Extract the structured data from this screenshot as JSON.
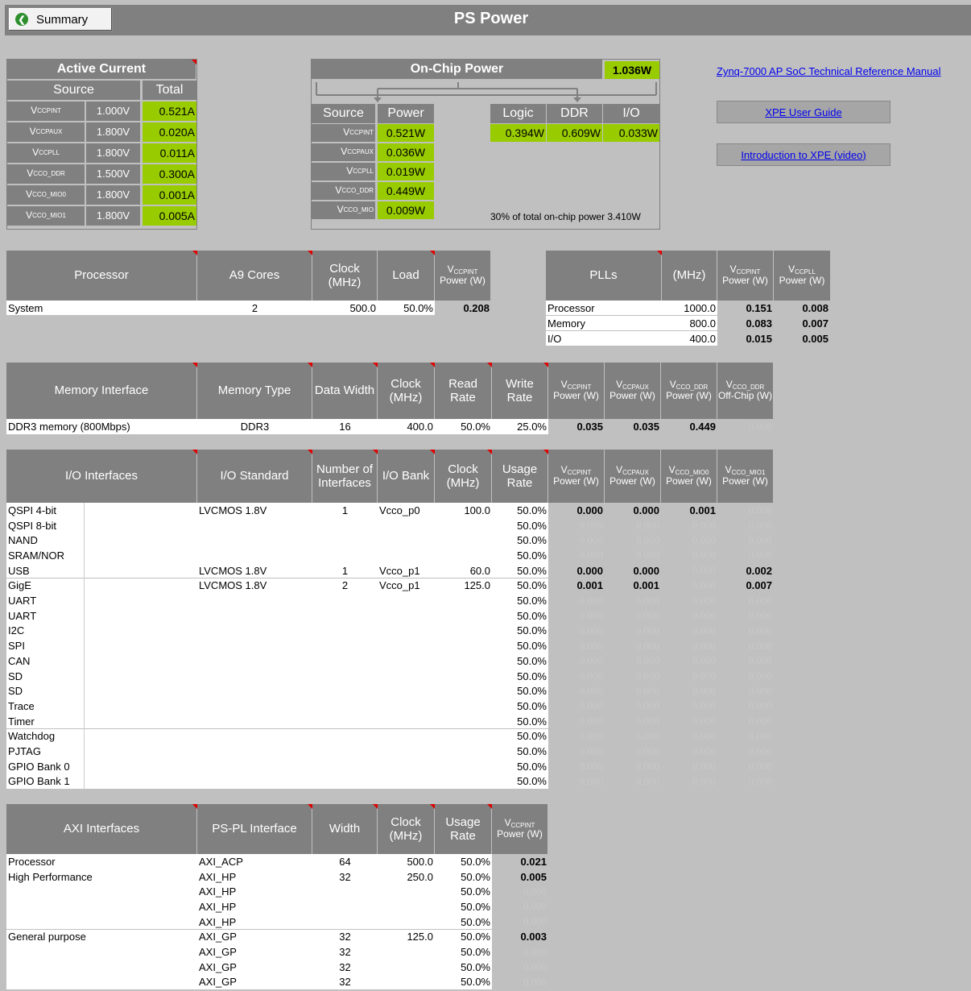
{
  "summary_label": "Summary",
  "page_title": "PS Power",
  "links": [
    "Zynq-7000 AP SoC Technical Reference Manual",
    "XPE User Guide",
    "Introduction to XPE (video)"
  ],
  "active_current": {
    "title": "Active Current",
    "headers": [
      "Source",
      "Total"
    ],
    "rows": [
      {
        "src": "CCPINT",
        "v": "1.000V",
        "a": "0.521A"
      },
      {
        "src": "CCPAUX",
        "v": "1.800V",
        "a": "0.020A"
      },
      {
        "src": "CCPLL",
        "v": "1.800V",
        "a": "0.011A"
      },
      {
        "src": "CCO_DDR",
        "v": "1.500V",
        "a": "0.300A"
      },
      {
        "src": "CCO_MIO0",
        "v": "1.800V",
        "a": "0.001A"
      },
      {
        "src": "CCO_MIO1",
        "v": "1.800V",
        "a": "0.005A"
      }
    ]
  },
  "onchip": {
    "title": "On-Chip Power",
    "total": "1.036W",
    "headers": [
      "Source",
      "Power",
      "Logic",
      "DDR",
      "I/O"
    ],
    "rows": [
      {
        "src": "CCPINT",
        "p": "0.521W"
      },
      {
        "src": "CCPAUX",
        "p": "0.036W"
      },
      {
        "src": "CCPLL",
        "p": "0.019W"
      },
      {
        "src": "CCO_DDR",
        "p": "0.449W"
      },
      {
        "src": "CCO_MIO",
        "p": "0.009W"
      }
    ],
    "logic": "0.394W",
    "ddr": "0.609W",
    "io": "0.033W",
    "note": "30% of total on-chip power 3.410W"
  },
  "processor": {
    "headers": [
      "Processor",
      "A9 Cores",
      "Clock (MHz)",
      "Load",
      "Power (W)"
    ],
    "row": {
      "name": "System",
      "cores": "2",
      "clock": "500.0",
      "load": "50.0%",
      "power": "0.208"
    }
  },
  "plls": {
    "headers": [
      "PLLs",
      "(MHz)",
      "Power (W)",
      "Power (W)"
    ],
    "rows": [
      {
        "name": "Processor",
        "mhz": "1000.0",
        "p1": "0.151",
        "p2": "0.008"
      },
      {
        "name": "Memory",
        "mhz": "800.0",
        "p1": "0.083",
        "p2": "0.007"
      },
      {
        "name": "I/O",
        "mhz": "400.0",
        "p1": "0.015",
        "p2": "0.005"
      }
    ]
  },
  "memory": {
    "headers": [
      "Memory Interface",
      "Memory Type",
      "Data Width",
      "Clock (MHz)",
      "Read Rate",
      "Write Rate",
      "Power (W)",
      "Power (W)",
      "Power (W)",
      "Off-Chip (W)"
    ],
    "row": {
      "name": "DDR3 memory (800Mbps)",
      "type": "DDR3",
      "width": "16",
      "clock": "400.0",
      "read": "50.0%",
      "write": "25.0%",
      "p1": "0.035",
      "p2": "0.035",
      "p3": "0.449",
      "p4": "0.000"
    }
  },
  "io": {
    "headers": [
      "I/O Interfaces",
      "I/O Standard",
      "Number of Interfaces",
      "I/O Bank",
      "Clock (MHz)",
      "Usage Rate",
      "Power (W)",
      "Power (W)",
      "Power (W)",
      "Power (W)"
    ],
    "rows": [
      {
        "name": "QSPI 4-bit",
        "std": "LVCMOS 1.8V",
        "num": "1",
        "bank": "Vcco_p0",
        "clk": "100.0",
        "rate": "50.0%",
        "p": [
          "0.000",
          "0.000",
          "0.001",
          "0.000"
        ],
        "on": [
          1,
          1,
          1,
          0
        ]
      },
      {
        "name": "QSPI 8-bit",
        "std": "",
        "num": "",
        "bank": "",
        "clk": "",
        "rate": "50.0%",
        "p": [
          "0.000",
          "0.000",
          "0.000",
          "0.000"
        ],
        "on": [
          0,
          0,
          0,
          0
        ]
      },
      {
        "name": "NAND",
        "std": "",
        "num": "",
        "bank": "",
        "clk": "",
        "rate": "50.0%",
        "p": [
          "0.000",
          "0.000",
          "0.000",
          "0.000"
        ],
        "on": [
          0,
          0,
          0,
          0
        ]
      },
      {
        "name": "SRAM/NOR",
        "std": "",
        "num": "",
        "bank": "",
        "clk": "",
        "rate": "50.0%",
        "p": [
          "0.000",
          "0.000",
          "0.000",
          "0.000"
        ],
        "on": [
          0,
          0,
          0,
          0
        ]
      },
      {
        "name": "USB",
        "std": "LVCMOS 1.8V",
        "num": "1",
        "bank": "Vcco_p1",
        "clk": "60.0",
        "rate": "50.0%",
        "p": [
          "0.000",
          "0.000",
          "0.000",
          "0.002"
        ],
        "on": [
          1,
          1,
          0,
          1
        ]
      },
      {
        "name": "GigE",
        "std": "LVCMOS 1.8V",
        "num": "2",
        "bank": "Vcco_p1",
        "clk": "125.0",
        "rate": "50.0%",
        "p": [
          "0.001",
          "0.001",
          "0.000",
          "0.007"
        ],
        "on": [
          1,
          1,
          0,
          1
        ]
      },
      {
        "name": "UART",
        "std": "",
        "num": "",
        "bank": "",
        "clk": "",
        "rate": "50.0%",
        "p": [
          "0.000",
          "0.000",
          "0.000",
          "0.000"
        ],
        "on": [
          0,
          0,
          0,
          0
        ]
      },
      {
        "name": "UART",
        "std": "",
        "num": "",
        "bank": "",
        "clk": "",
        "rate": "50.0%",
        "p": [
          "0.000",
          "0.000",
          "0.000",
          "0.000"
        ],
        "on": [
          0,
          0,
          0,
          0
        ]
      },
      {
        "name": "I2C",
        "std": "",
        "num": "",
        "bank": "",
        "clk": "",
        "rate": "50.0%",
        "p": [
          "0.000",
          "0.000",
          "0.000",
          "0.000"
        ],
        "on": [
          0,
          0,
          0,
          0
        ]
      },
      {
        "name": "SPI",
        "std": "",
        "num": "",
        "bank": "",
        "clk": "",
        "rate": "50.0%",
        "p": [
          "0.000",
          "0.000",
          "0.000",
          "0.000"
        ],
        "on": [
          0,
          0,
          0,
          0
        ]
      },
      {
        "name": "CAN",
        "std": "",
        "num": "",
        "bank": "",
        "clk": "",
        "rate": "50.0%",
        "p": [
          "0.000",
          "0.000",
          "0.000",
          "0.000"
        ],
        "on": [
          0,
          0,
          0,
          0
        ]
      },
      {
        "name": "SD",
        "std": "",
        "num": "",
        "bank": "",
        "clk": "",
        "rate": "50.0%",
        "p": [
          "0.000",
          "0.000",
          "0.000",
          "0.000"
        ],
        "on": [
          0,
          0,
          0,
          0
        ]
      },
      {
        "name": "SD",
        "std": "",
        "num": "",
        "bank": "",
        "clk": "",
        "rate": "50.0%",
        "p": [
          "0.000",
          "0.000",
          "0.000",
          "0.000"
        ],
        "on": [
          0,
          0,
          0,
          0
        ]
      },
      {
        "name": "Trace",
        "std": "",
        "num": "",
        "bank": "",
        "clk": "",
        "rate": "50.0%",
        "p": [
          "0.000",
          "0.000",
          "0.000",
          "0.000"
        ],
        "on": [
          0,
          0,
          0,
          0
        ]
      },
      {
        "name": "Timer",
        "std": "",
        "num": "",
        "bank": "",
        "clk": "",
        "rate": "50.0%",
        "p": [
          "0.000",
          "0.000",
          "0.000",
          "0.000"
        ],
        "on": [
          0,
          0,
          0,
          0
        ]
      },
      {
        "name": "Watchdog",
        "std": "",
        "num": "",
        "bank": "",
        "clk": "",
        "rate": "50.0%",
        "p": [
          "0.000",
          "0.000",
          "0.000",
          "0.000"
        ],
        "on": [
          0,
          0,
          0,
          0
        ]
      },
      {
        "name": "PJTAG",
        "std": "",
        "num": "",
        "bank": "",
        "clk": "",
        "rate": "50.0%",
        "p": [
          "0.000",
          "0.000",
          "0.000",
          "0.000"
        ],
        "on": [
          0,
          0,
          0,
          0
        ]
      },
      {
        "name": "GPIO Bank 0",
        "std": "",
        "num": "",
        "bank": "",
        "clk": "",
        "rate": "50.0%",
        "p": [
          "0.000",
          "0.000",
          "0.000",
          "0.000"
        ],
        "on": [
          0,
          0,
          0,
          0
        ]
      },
      {
        "name": "GPIO Bank 1",
        "std": "",
        "num": "",
        "bank": "",
        "clk": "",
        "rate": "50.0%",
        "p": [
          "0.000",
          "0.000",
          "0.000",
          "0.000"
        ],
        "on": [
          0,
          0,
          0,
          0
        ]
      }
    ]
  },
  "axi": {
    "headers": [
      "AXI Interfaces",
      "PS-PL Interface",
      "Width",
      "Clock (MHz)",
      "Usage Rate",
      "Power (W)"
    ],
    "rows": [
      {
        "name": "Processor",
        "iface": "AXI_ACP",
        "width": "64",
        "clk": "500.0",
        "rate": "50.0%",
        "p": "0.021",
        "on": 1
      },
      {
        "name": "High Performance",
        "iface": "AXI_HP",
        "width": "32",
        "clk": "250.0",
        "rate": "50.0%",
        "p": "0.005",
        "on": 1
      },
      {
        "name": "",
        "iface": "AXI_HP",
        "width": "",
        "clk": "",
        "rate": "50.0%",
        "p": "0.000",
        "on": 0
      },
      {
        "name": "",
        "iface": "AXI_HP",
        "width": "",
        "clk": "",
        "rate": "50.0%",
        "p": "0.000",
        "on": 0
      },
      {
        "name": "",
        "iface": "AXI_HP",
        "width": "",
        "clk": "",
        "rate": "50.0%",
        "p": "0.000",
        "on": 0
      },
      {
        "name": "General purpose",
        "iface": "AXI_GP",
        "width": "32",
        "clk": "125.0",
        "rate": "50.0%",
        "p": "0.003",
        "on": 1
      },
      {
        "name": "",
        "iface": "AXI_GP",
        "width": "32",
        "clk": "",
        "rate": "50.0%",
        "p": "0.000",
        "on": 0
      },
      {
        "name": "",
        "iface": "AXI_GP",
        "width": "32",
        "clk": "",
        "rate": "50.0%",
        "p": "0.000",
        "on": 0
      },
      {
        "name": "",
        "iface": "AXI_GP",
        "width": "32",
        "clk": "",
        "rate": "50.0%",
        "p": "0.000",
        "on": 0
      }
    ]
  }
}
